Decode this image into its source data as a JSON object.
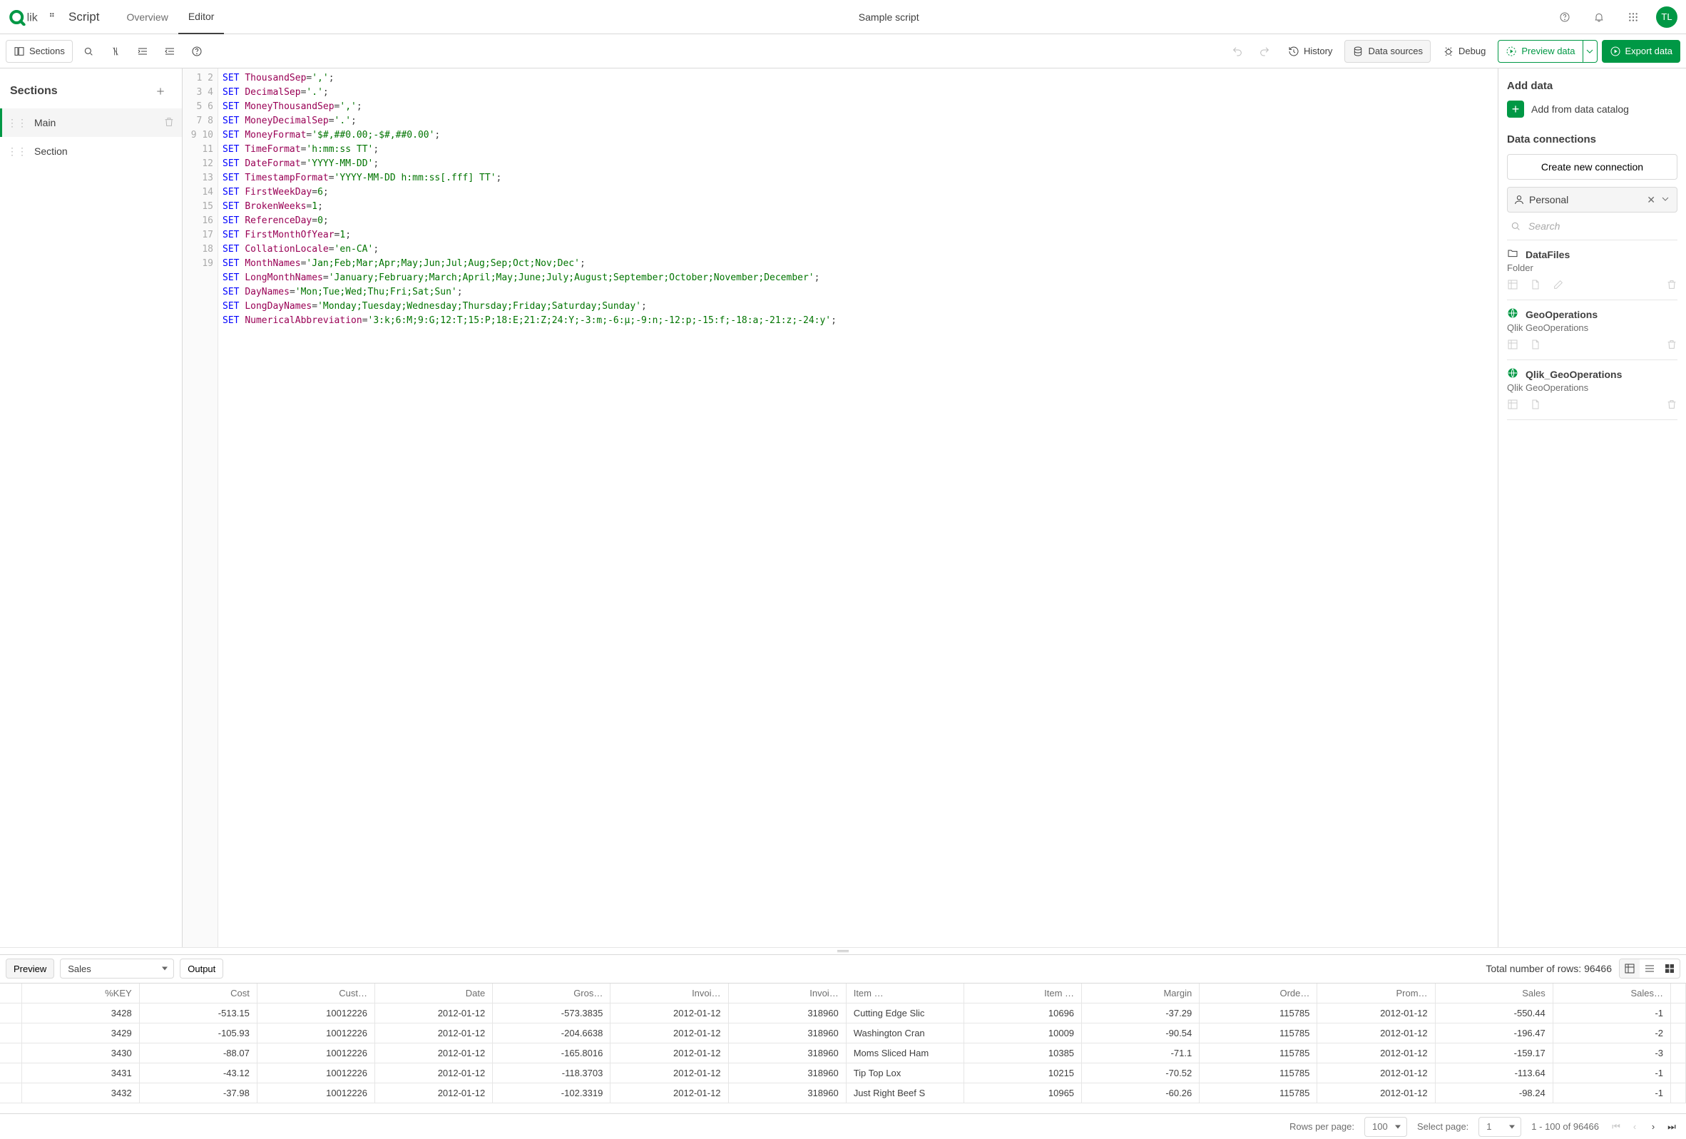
{
  "app": {
    "brand": "Qlik",
    "label": "Script",
    "tabs": {
      "overview": "Overview",
      "editor": "Editor"
    },
    "title": "Sample script",
    "avatar": "TL"
  },
  "toolbar": {
    "sections": "Sections",
    "history": "History",
    "data_sources": "Data sources",
    "debug": "Debug",
    "preview_data": "Preview data",
    "export_data": "Export data"
  },
  "sections_panel": {
    "heading": "Sections",
    "items": [
      {
        "label": "Main",
        "active": true
      },
      {
        "label": "Section",
        "active": false
      }
    ]
  },
  "code_lines": [
    {
      "k": "SET",
      "v": "ThousandSep",
      "rest": "=',';"
    },
    {
      "k": "SET",
      "v": "DecimalSep",
      "rest": "='.';"
    },
    {
      "k": "SET",
      "v": "MoneyThousandSep",
      "rest": "=',';"
    },
    {
      "k": "SET",
      "v": "MoneyDecimalSep",
      "rest": "='.';"
    },
    {
      "k": "SET",
      "v": "MoneyFormat",
      "rest": "='$#,##0.00;-$#,##0.00';"
    },
    {
      "k": "SET",
      "v": "TimeFormat",
      "rest": "='h:mm:ss TT';"
    },
    {
      "k": "SET",
      "v": "DateFormat",
      "rest": "='YYYY-MM-DD';"
    },
    {
      "k": "SET",
      "v": "TimestampFormat",
      "rest": "='YYYY-MM-DD h:mm:ss[.fff] TT';"
    },
    {
      "k": "SET",
      "v": "FirstWeekDay",
      "rest": "=6;"
    },
    {
      "k": "SET",
      "v": "BrokenWeeks",
      "rest": "=1;"
    },
    {
      "k": "SET",
      "v": "ReferenceDay",
      "rest": "=0;"
    },
    {
      "k": "SET",
      "v": "FirstMonthOfYear",
      "rest": "=1;"
    },
    {
      "k": "SET",
      "v": "CollationLocale",
      "rest": "='en-CA';"
    },
    {
      "k": "SET",
      "v": "MonthNames",
      "rest": "='Jan;Feb;Mar;Apr;May;Jun;Jul;Aug;Sep;Oct;Nov;Dec';"
    },
    {
      "k": "SET",
      "v": "LongMonthNames",
      "rest": "='January;February;March;April;May;June;July;August;September;October;November;December';"
    },
    {
      "k": "SET",
      "v": "DayNames",
      "rest": "='Mon;Tue;Wed;Thu;Fri;Sat;Sun';"
    },
    {
      "k": "SET",
      "v": "LongDayNames",
      "rest": "='Monday;Tuesday;Wednesday;Thursday;Friday;Saturday;Sunday';"
    },
    {
      "k": "SET",
      "v": "NumericalAbbreviation",
      "rest": "='3:k;6:M;9:G;12:T;15:P;18:E;21:Z;24:Y;-3:m;-6:μ;-9:n;-12:p;-15:f;-18:a;-21:z;-24:y';"
    }
  ],
  "right": {
    "add_data": "Add data",
    "add_from_catalog": "Add from data catalog",
    "data_connections": "Data connections",
    "create_new": "Create new connection",
    "space": "Personal",
    "search_placeholder": "Search",
    "items": [
      {
        "title": "DataFiles",
        "sub": "Folder",
        "icon": "folder"
      },
      {
        "title": "GeoOperations",
        "sub": "Qlik GeoOperations",
        "icon": "globe"
      },
      {
        "title": "Qlik_GeoOperations",
        "sub": "Qlik GeoOperations",
        "icon": "globe"
      }
    ]
  },
  "bottom": {
    "preview": "Preview",
    "output": "Output",
    "table_selected": "Sales",
    "total_rows_label": "Total number of rows: ",
    "total_rows": "96466",
    "columns": [
      "%KEY",
      "Cost",
      "Cust…",
      "Date",
      "Gros…",
      "Invoi…",
      "Invoi…",
      "Item …",
      "Item …",
      "Margin",
      "Orde…",
      "Prom…",
      "Sales",
      "Sales…"
    ],
    "rows": [
      [
        "3428",
        "-513.15",
        "10012226",
        "2012-01-12",
        "-573.3835",
        "2012-01-12",
        "318960",
        "Cutting Edge Slic",
        "10696",
        "-37.29",
        "115785",
        "2012-01-12",
        "-550.44",
        "-1"
      ],
      [
        "3429",
        "-105.93",
        "10012226",
        "2012-01-12",
        "-204.6638",
        "2012-01-12",
        "318960",
        "Washington Cran",
        "10009",
        "-90.54",
        "115785",
        "2012-01-12",
        "-196.47",
        "-2"
      ],
      [
        "3430",
        "-88.07",
        "10012226",
        "2012-01-12",
        "-165.8016",
        "2012-01-12",
        "318960",
        "Moms Sliced Ham",
        "10385",
        "-71.1",
        "115785",
        "2012-01-12",
        "-159.17",
        "-3"
      ],
      [
        "3431",
        "-43.12",
        "10012226",
        "2012-01-12",
        "-118.3703",
        "2012-01-12",
        "318960",
        "Tip Top Lox",
        "10215",
        "-70.52",
        "115785",
        "2012-01-12",
        "-113.64",
        "-1"
      ],
      [
        "3432",
        "-37.98",
        "10012226",
        "2012-01-12",
        "-102.3319",
        "2012-01-12",
        "318960",
        "Just Right Beef S",
        "10965",
        "-60.26",
        "115785",
        "2012-01-12",
        "-98.24",
        "-1"
      ]
    ],
    "pager": {
      "rows_per_page_label": "Rows per page:",
      "rows_per_page": "100",
      "select_page_label": "Select page:",
      "select_page": "1",
      "range": "1 - 100 of 96466"
    }
  }
}
